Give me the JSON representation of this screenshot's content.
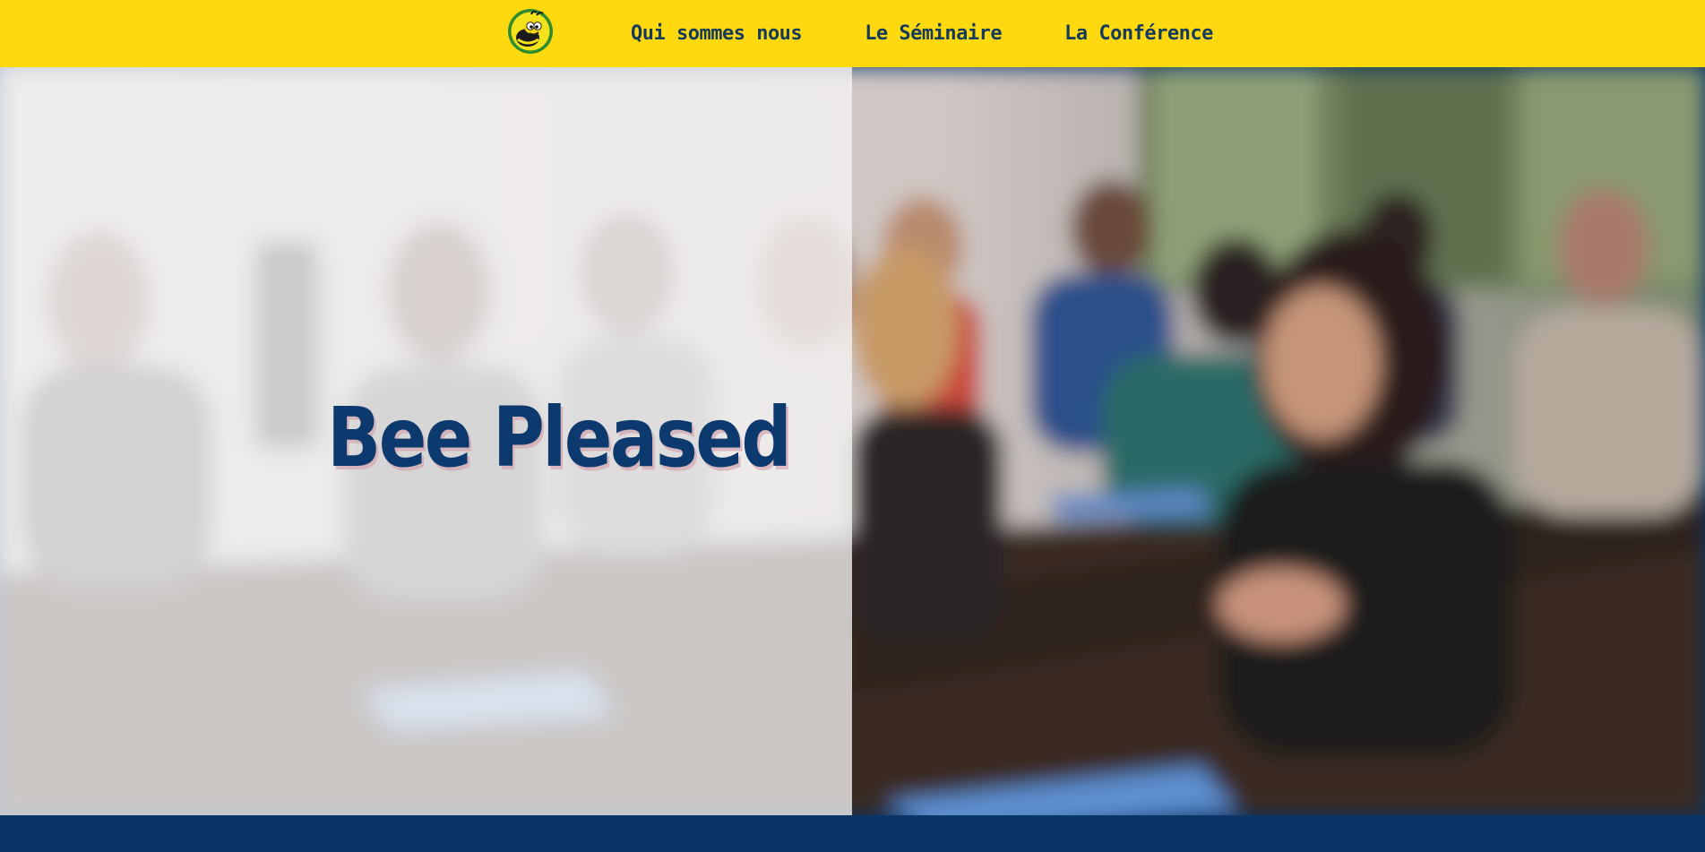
{
  "header": {
    "logo_icon": "bee-mascot-icon",
    "background_color": "#ffd90f",
    "nav": [
      {
        "label": "Qui sommes nous"
      },
      {
        "label": "Le Séminaire"
      },
      {
        "label": "La Conférence"
      }
    ]
  },
  "hero": {
    "title": "Bee Pleased",
    "title_color": "#0d3a6e",
    "image": "blurred-photo-of-people-applauding-in-a-meeting-room"
  },
  "footer": {
    "background_color": "#0a3566"
  }
}
